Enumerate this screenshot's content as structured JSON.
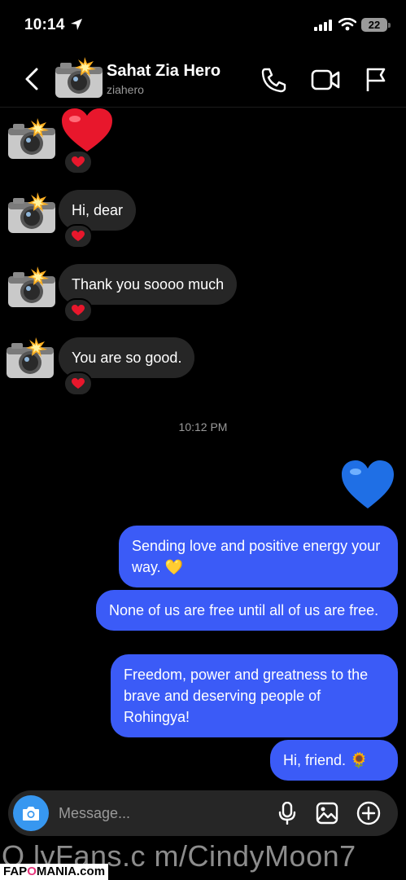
{
  "status_bar": {
    "time": "10:14",
    "battery": "22"
  },
  "header": {
    "contact_name": "Sahat Zia Hero",
    "username": "ziahero"
  },
  "colors": {
    "outgoing_bubble": "#3b5bf7",
    "incoming_bubble": "#262626",
    "heart": "#e8172c",
    "blue_heart": "#1f6fe5",
    "camera_button": "#3797f0"
  },
  "incoming_messages": [
    {
      "text": "Hi, dear",
      "reaction": "red-heart"
    },
    {
      "text": "Thank you soooo much",
      "reaction": "red-heart"
    },
    {
      "text": "You are so good.",
      "reaction": "red-heart"
    }
  ],
  "first_message": {
    "content": "red-heart-emoji",
    "reaction": "red-heart"
  },
  "timestamp": "10:12 PM",
  "outgoing_messages": [
    {
      "text": "blue-heart-emoji"
    },
    {
      "text": "Sending love and positive energy your way. 💛"
    },
    {
      "text": "None of us are free until all of us are free."
    },
    {
      "text": "Freedom, power and greatness to the brave and deserving people of Rohingya!"
    },
    {
      "text": "Hi, friend. 🌻"
    }
  ],
  "composer": {
    "placeholder": "Message..."
  },
  "watermark": {
    "text": "O lyFans.c m/CindyMoon7",
    "brand_prefix": "FAP",
    "brand_o": "O",
    "brand_suffix": "MANIA.com"
  }
}
